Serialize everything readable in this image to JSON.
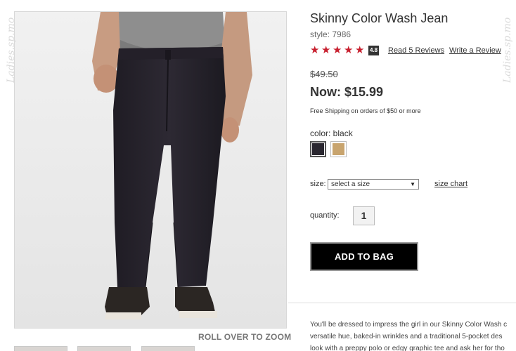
{
  "product": {
    "title": "Skinny Color Wash Jean",
    "style": "style: 7986",
    "rating": 4.8,
    "rating_label": "4.8",
    "stars": 5,
    "read_reviews": "Read 5 Reviews",
    "write_review": "Write a Review",
    "old_price": "$49.50",
    "now_price": "Now: $15.99",
    "shipping": "Free Shipping on orders of $50 or more"
  },
  "options": {
    "color_label": "color: black",
    "swatches": [
      {
        "name": "black",
        "color": "#2a2730",
        "selected": true
      },
      {
        "name": "khaki",
        "color": "#c8a46e",
        "selected": false
      }
    ],
    "size_label": "size:",
    "size_placeholder": "select a size",
    "size_chart": "size chart",
    "quantity_label": "quantity:",
    "quantity_value": "1"
  },
  "actions": {
    "add_to_bag": "ADD TO BAG"
  },
  "image": {
    "zoom_hint": "ROLL OVER TO ZOOM"
  },
  "description": {
    "lines": [
      "You'll be dressed to impress the girl in our Skinny Color Wash c",
      "versatile hue, baked-in wrinkles and a traditional 5-pocket des",
      "look with a preppy polo or edgy graphic tee and ask her for tho"
    ]
  },
  "watermark": "Ladies.sp.mo",
  "colors": {
    "star": "#c8202f",
    "button_bg": "#000000",
    "button_text": "#ffffff"
  }
}
